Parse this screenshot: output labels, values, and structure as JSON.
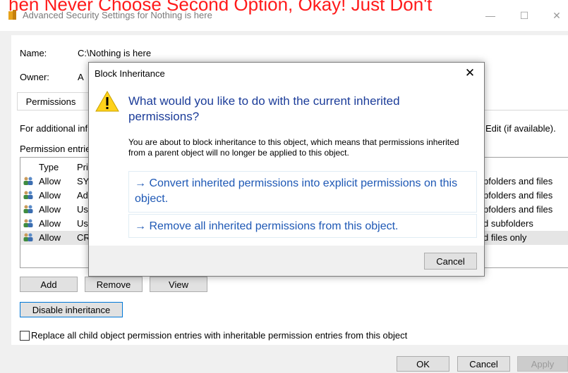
{
  "overlay_caption": "hen Never Choose Second Option, Okay! Just Don't",
  "window": {
    "title": "Advanced Security Settings for Nothing is here",
    "minimize": "—",
    "maximize": "☐",
    "close": "✕"
  },
  "fields": {
    "name_label": "Name:",
    "name_value": "C:\\Nothing is here",
    "owner_label": "Owner:",
    "owner_value_partial": "A"
  },
  "tabs": {
    "permissions": "Permissions"
  },
  "text": {
    "additional_info_partial": "For additional inf",
    "edit_hint_partial": "Edit (if available).",
    "entries_label_partial": "Permission entrie"
  },
  "table": {
    "col_type": "Type",
    "col_principal_partial": "Pri",
    "rows": [
      {
        "type": "Allow",
        "principal": "SYS",
        "applies": "bfolders and files",
        "selected": false
      },
      {
        "type": "Allow",
        "principal": "Ad",
        "applies": "bfolders and files",
        "selected": false
      },
      {
        "type": "Allow",
        "principal": "Use",
        "applies": "bfolders and files",
        "selected": false
      },
      {
        "type": "Allow",
        "principal": "Use",
        "applies": "d subfolders",
        "selected": false
      },
      {
        "type": "Allow",
        "principal": "CRI",
        "applies": "d files only",
        "selected": true
      }
    ]
  },
  "buttons": {
    "add": "Add",
    "remove": "Remove",
    "view": "View",
    "disable_inheritance": "Disable inheritance",
    "ok": "OK",
    "cancel": "Cancel",
    "apply": "Apply"
  },
  "checkbox": {
    "replace_label": "Replace all child object permission entries with inheritable permission entries from this object",
    "checked": false
  },
  "dialog": {
    "title": "Block Inheritance",
    "close": "✕",
    "heading": "What would you like to do with the current inherited permissions?",
    "description": "You are about to block inheritance to this object, which means that permissions inherited from a parent object will no longer be applied to this object.",
    "option_convert": "Convert inherited permissions into explicit permissions on this object.",
    "option_remove": "Remove all inherited permissions from this object.",
    "arrow": "→",
    "cancel": "Cancel"
  },
  "colors": {
    "caption_red": "#ff1a1a",
    "heading_blue": "#1b3c99",
    "link_blue": "#1e58b5",
    "focus_blue": "#0078d7"
  }
}
